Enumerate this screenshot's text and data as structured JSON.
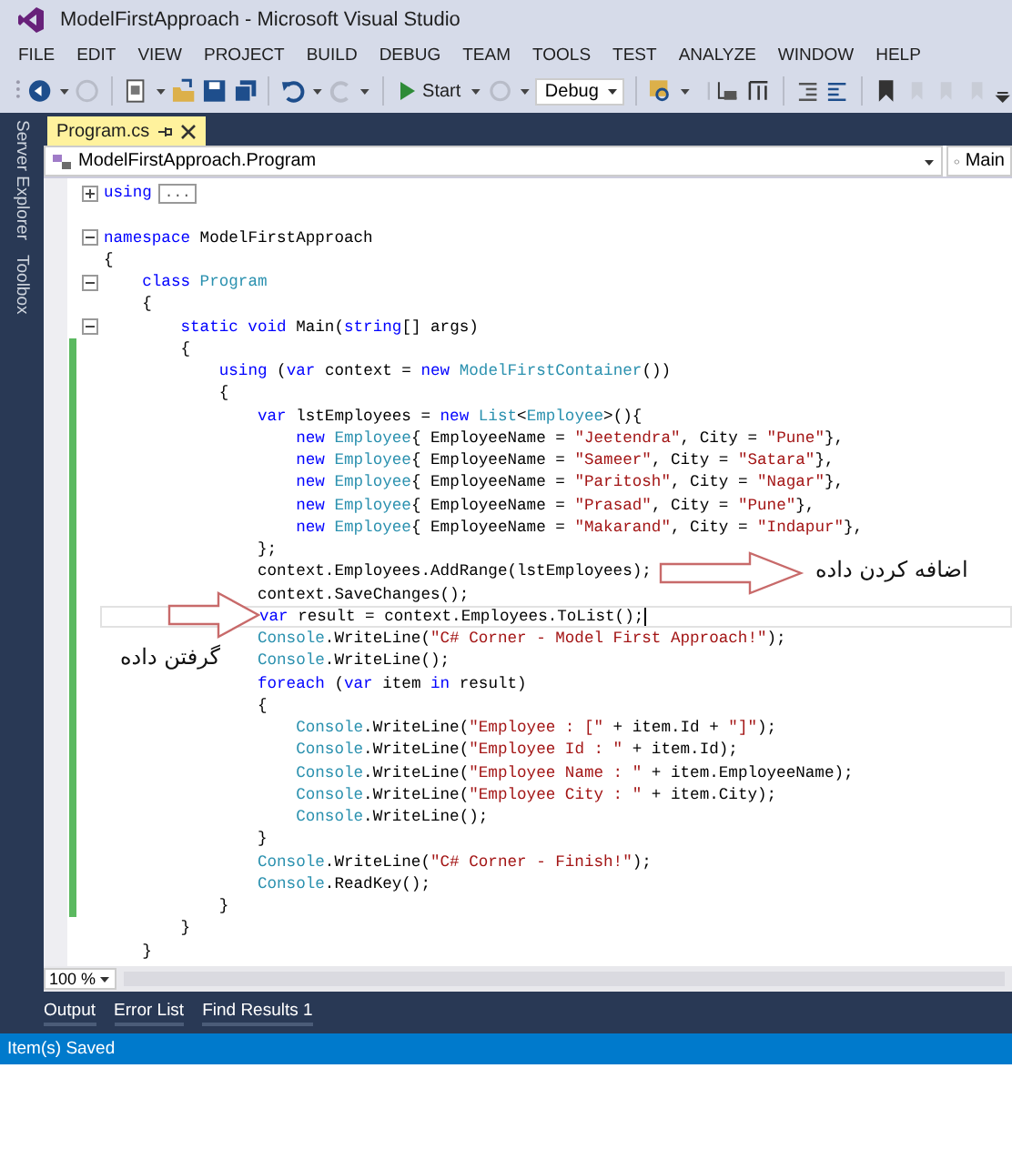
{
  "window": {
    "title": "ModelFirstApproach - Microsoft Visual Studio"
  },
  "menu": [
    "FILE",
    "EDIT",
    "VIEW",
    "PROJECT",
    "BUILD",
    "DEBUG",
    "TEAM",
    "TOOLS",
    "TEST",
    "ANALYZE",
    "WINDOW",
    "HELP"
  ],
  "toolbar": {
    "start_button": "Start",
    "configuration": "Debug"
  },
  "side_tabs": [
    "Server Explorer",
    "Toolbox"
  ],
  "document_tab": {
    "label": "Program.cs",
    "selected": true
  },
  "navigation": {
    "type_dropdown": "ModelFirstApproach.Program",
    "member_dropdown": "Main"
  },
  "code_lines": [
    {
      "changed": false,
      "current": false,
      "expanded": false,
      "folded_text": "...",
      "segments": [
        {
          "kind": "keyword",
          "text": "using"
        }
      ]
    },
    {
      "changed": false,
      "current": false
    },
    {
      "changed": false,
      "current": false,
      "expanded": true,
      "segments": [
        {
          "kind": "keyword",
          "text": "namespace"
        },
        {
          "kind": "plain",
          "text": " ModelFirstApproach"
        }
      ]
    },
    {
      "changed": false,
      "current": false,
      "segments": [
        {
          "kind": "plain",
          "text": "{"
        }
      ]
    },
    {
      "changed": false,
      "current": false,
      "expanded": true,
      "segments": [
        {
          "kind": "keyword",
          "text": "    class"
        },
        {
          "kind": "type",
          "text": " Program"
        }
      ]
    },
    {
      "changed": false,
      "current": false,
      "segments": [
        {
          "kind": "plain",
          "text": "    {"
        }
      ]
    },
    {
      "changed": false,
      "current": false,
      "expanded": true,
      "segments": [
        {
          "kind": "keyword",
          "text": "        static void"
        },
        {
          "kind": "plain",
          "text": " Main("
        },
        {
          "kind": "keyword",
          "text": "string"
        },
        {
          "kind": "plain",
          "text": "[] args)"
        }
      ]
    },
    {
      "changed": true,
      "current": false,
      "segments": [
        {
          "kind": "plain",
          "text": "        {"
        }
      ]
    },
    {
      "changed": true,
      "current": false,
      "segments": [
        {
          "kind": "keyword",
          "text": "            using"
        },
        {
          "kind": "plain",
          "text": " ("
        },
        {
          "kind": "keyword",
          "text": "var"
        },
        {
          "kind": "plain",
          "text": " context = "
        },
        {
          "kind": "keyword",
          "text": "new"
        },
        {
          "kind": "type",
          "text": " ModelFirstContainer"
        },
        {
          "kind": "plain",
          "text": "())"
        }
      ]
    },
    {
      "changed": true,
      "current": false,
      "segments": [
        {
          "kind": "plain",
          "text": "            {"
        }
      ]
    },
    {
      "changed": true,
      "current": false,
      "segments": [
        {
          "kind": "keyword",
          "text": "                var"
        },
        {
          "kind": "plain",
          "text": " lstEmployees = "
        },
        {
          "kind": "keyword",
          "text": "new"
        },
        {
          "kind": "type",
          "text": " List"
        },
        {
          "kind": "plain",
          "text": "<"
        },
        {
          "kind": "type",
          "text": "Employee"
        },
        {
          "kind": "plain",
          "text": ">(){"
        }
      ]
    },
    {
      "changed": true,
      "current": false,
      "segments": [
        {
          "kind": "keyword",
          "text": "                    new"
        },
        {
          "kind": "type",
          "text": " Employee"
        },
        {
          "kind": "plain",
          "text": "{ EmployeeName = "
        },
        {
          "kind": "string",
          "text": "\"Jeetendra\""
        },
        {
          "kind": "plain",
          "text": ", City = "
        },
        {
          "kind": "string",
          "text": "\"Pune\""
        },
        {
          "kind": "plain",
          "text": "},"
        }
      ]
    },
    {
      "changed": true,
      "current": false,
      "segments": [
        {
          "kind": "keyword",
          "text": "                    new"
        },
        {
          "kind": "type",
          "text": " Employee"
        },
        {
          "kind": "plain",
          "text": "{ EmployeeName = "
        },
        {
          "kind": "string",
          "text": "\"Sameer\""
        },
        {
          "kind": "plain",
          "text": ", City = "
        },
        {
          "kind": "string",
          "text": "\"Satara\""
        },
        {
          "kind": "plain",
          "text": "},"
        }
      ]
    },
    {
      "changed": true,
      "current": false,
      "segments": [
        {
          "kind": "keyword",
          "text": "                    new"
        },
        {
          "kind": "type",
          "text": " Employee"
        },
        {
          "kind": "plain",
          "text": "{ EmployeeName = "
        },
        {
          "kind": "string",
          "text": "\"Paritosh\""
        },
        {
          "kind": "plain",
          "text": ", City = "
        },
        {
          "kind": "string",
          "text": "\"Nagar\""
        },
        {
          "kind": "plain",
          "text": "},"
        }
      ]
    },
    {
      "changed": true,
      "current": false,
      "segments": [
        {
          "kind": "keyword",
          "text": "                    new"
        },
        {
          "kind": "type",
          "text": " Employee"
        },
        {
          "kind": "plain",
          "text": "{ EmployeeName = "
        },
        {
          "kind": "string",
          "text": "\"Prasad\""
        },
        {
          "kind": "plain",
          "text": ", City = "
        },
        {
          "kind": "string",
          "text": "\"Pune\""
        },
        {
          "kind": "plain",
          "text": "},"
        }
      ]
    },
    {
      "changed": true,
      "current": false,
      "segments": [
        {
          "kind": "keyword",
          "text": "                    new"
        },
        {
          "kind": "type",
          "text": " Employee"
        },
        {
          "kind": "plain",
          "text": "{ EmployeeName = "
        },
        {
          "kind": "string",
          "text": "\"Makarand\""
        },
        {
          "kind": "plain",
          "text": ", City = "
        },
        {
          "kind": "string",
          "text": "\"Indapur\""
        },
        {
          "kind": "plain",
          "text": "},"
        }
      ]
    },
    {
      "changed": true,
      "current": false,
      "segments": [
        {
          "kind": "plain",
          "text": "                };"
        }
      ]
    },
    {
      "changed": true,
      "current": false,
      "segments": [
        {
          "kind": "plain",
          "text": "                context.Employees.AddRange(lstEmployees);"
        }
      ]
    },
    {
      "changed": true,
      "current": false,
      "segments": [
        {
          "kind": "plain",
          "text": "                context.SaveChanges();"
        }
      ]
    },
    {
      "changed": true,
      "current": true,
      "segments": [
        {
          "kind": "keyword",
          "text": "                var"
        },
        {
          "kind": "plain",
          "text": " result = context.Employees.ToList();"
        }
      ]
    },
    {
      "changed": true,
      "current": false,
      "segments": [
        {
          "kind": "type",
          "text": "                Console"
        },
        {
          "kind": "plain",
          "text": ".WriteLine("
        },
        {
          "kind": "string",
          "text": "\"C# Corner - Model First Approach!\""
        },
        {
          "kind": "plain",
          "text": ");"
        }
      ]
    },
    {
      "changed": true,
      "current": false,
      "segments": [
        {
          "kind": "type",
          "text": "                Console"
        },
        {
          "kind": "plain",
          "text": ".WriteLine();"
        }
      ]
    },
    {
      "changed": true,
      "current": false,
      "segments": [
        {
          "kind": "keyword",
          "text": "                foreach"
        },
        {
          "kind": "plain",
          "text": " ("
        },
        {
          "kind": "keyword",
          "text": "var"
        },
        {
          "kind": "plain",
          "text": " item "
        },
        {
          "kind": "keyword",
          "text": "in"
        },
        {
          "kind": "plain",
          "text": " result)"
        }
      ]
    },
    {
      "changed": true,
      "current": false,
      "segments": [
        {
          "kind": "plain",
          "text": "                {"
        }
      ]
    },
    {
      "changed": true,
      "current": false,
      "segments": [
        {
          "kind": "type",
          "text": "                    Console"
        },
        {
          "kind": "plain",
          "text": ".WriteLine("
        },
        {
          "kind": "string",
          "text": "\"Employee : [\""
        },
        {
          "kind": "plain",
          "text": " + item.Id + "
        },
        {
          "kind": "string",
          "text": "\"]\""
        },
        {
          "kind": "plain",
          "text": ");"
        }
      ]
    },
    {
      "changed": true,
      "current": false,
      "segments": [
        {
          "kind": "type",
          "text": "                    Console"
        },
        {
          "kind": "plain",
          "text": ".WriteLine("
        },
        {
          "kind": "string",
          "text": "\"Employee Id : \""
        },
        {
          "kind": "plain",
          "text": " + item.Id);"
        }
      ]
    },
    {
      "changed": true,
      "current": false,
      "segments": [
        {
          "kind": "type",
          "text": "                    Console"
        },
        {
          "kind": "plain",
          "text": ".WriteLine("
        },
        {
          "kind": "string",
          "text": "\"Employee Name : \""
        },
        {
          "kind": "plain",
          "text": " + item.EmployeeName);"
        }
      ]
    },
    {
      "changed": true,
      "current": false,
      "segments": [
        {
          "kind": "type",
          "text": "                    Console"
        },
        {
          "kind": "plain",
          "text": ".WriteLine("
        },
        {
          "kind": "string",
          "text": "\"Employee City : \""
        },
        {
          "kind": "plain",
          "text": " + item.City);"
        }
      ]
    },
    {
      "changed": true,
      "current": false,
      "segments": [
        {
          "kind": "type",
          "text": "                    Console"
        },
        {
          "kind": "plain",
          "text": ".WriteLine();"
        }
      ]
    },
    {
      "changed": true,
      "current": false,
      "segments": [
        {
          "kind": "plain",
          "text": "                }"
        }
      ]
    },
    {
      "changed": true,
      "current": false,
      "segments": [
        {
          "kind": "type",
          "text": "                Console"
        },
        {
          "kind": "plain",
          "text": ".WriteLine("
        },
        {
          "kind": "string",
          "text": "\"C# Corner - Finish!\""
        },
        {
          "kind": "plain",
          "text": ");"
        }
      ]
    },
    {
      "changed": true,
      "current": false,
      "segments": [
        {
          "kind": "type",
          "text": "                Console"
        },
        {
          "kind": "plain",
          "text": ".ReadKey();"
        }
      ]
    },
    {
      "changed": true,
      "current": false,
      "segments": [
        {
          "kind": "plain",
          "text": "            }"
        }
      ]
    },
    {
      "changed": false,
      "current": false,
      "segments": [
        {
          "kind": "plain",
          "text": "        }"
        }
      ]
    },
    {
      "changed": false,
      "current": false,
      "segments": [
        {
          "kind": "plain",
          "text": "    }"
        }
      ]
    }
  ],
  "annotations": [
    {
      "text": "اضافه کردن داده"
    },
    {
      "text": "گرفتن داده"
    }
  ],
  "zoom": "100 %",
  "panel_tabs": [
    "Output",
    "Error List",
    "Find Results 1"
  ],
  "status_bar": "Item(s) Saved"
}
